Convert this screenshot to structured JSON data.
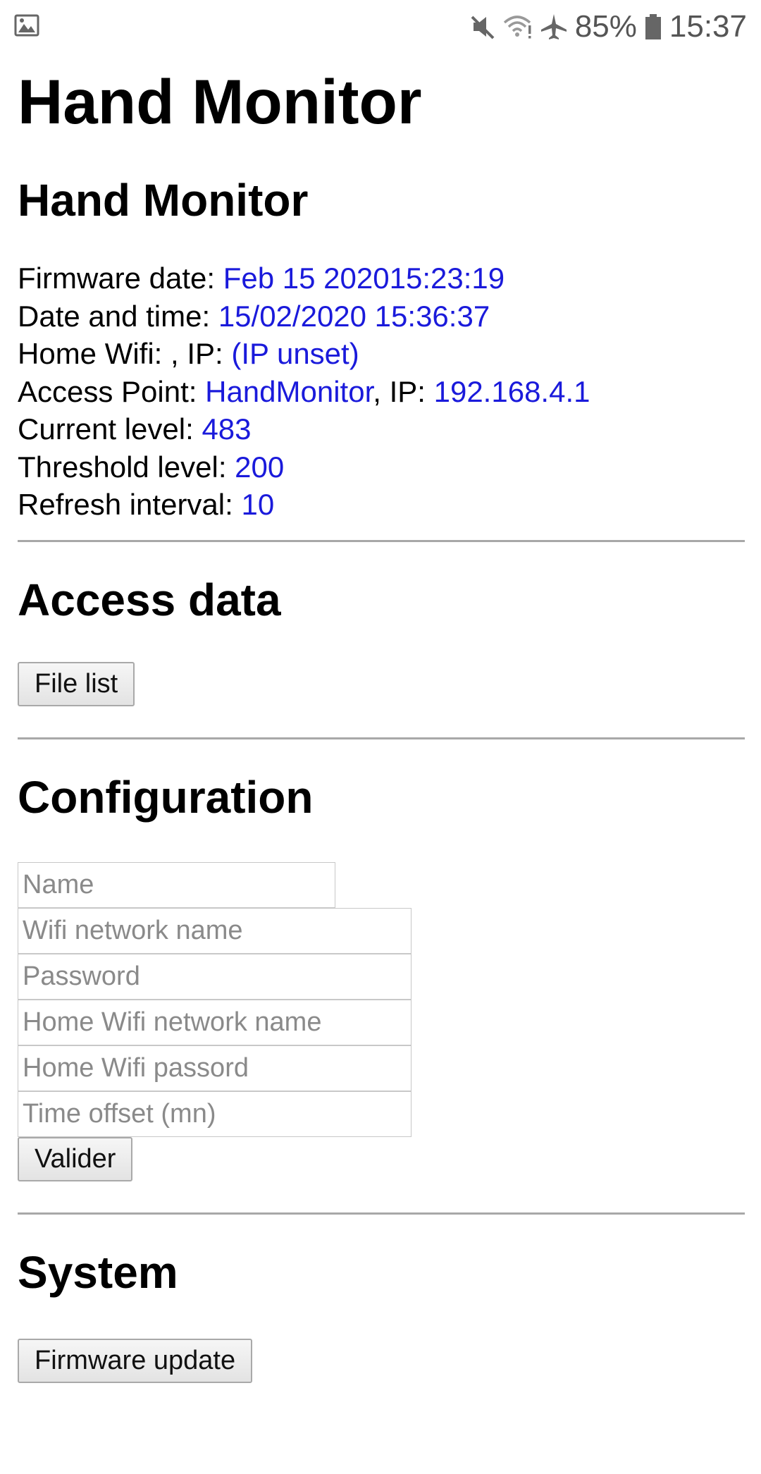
{
  "status_bar": {
    "battery": "85%",
    "time": "15:37",
    "icons": [
      "image-icon",
      "mute-icon",
      "wifi-icon",
      "airplane-icon",
      "battery-icon"
    ]
  },
  "page": {
    "title": "Hand Monitor"
  },
  "status_section": {
    "heading": "Hand Monitor",
    "rows": {
      "firmware_label": "Firmware date: ",
      "firmware_value": "Feb 15 202015:23:19",
      "datetime_label": "Date and time: ",
      "datetime_value": "15/02/2020 15:36:37",
      "home_wifi_label": "Home Wifi: , IP: ",
      "home_wifi_value": "(IP unset)",
      "ap_label": "Access Point: ",
      "ap_name": "HandMonitor",
      "ap_sep": ", IP: ",
      "ap_ip": "192.168.4.1",
      "current_label": "Current level: ",
      "current_value": "483",
      "threshold_label": "Threshold level: ",
      "threshold_value": "200",
      "refresh_label": "Refresh interval: ",
      "refresh_value": "10"
    }
  },
  "access_section": {
    "heading": "Access data",
    "file_list_label": "File list"
  },
  "config_section": {
    "heading": "Configuration",
    "placeholders": {
      "name": "Name",
      "wifi_name": "Wifi network name",
      "password": "Password",
      "home_wifi_name": "Home Wifi network name",
      "home_wifi_password": "Home Wifi passord",
      "time_offset": "Time offset (mn)"
    },
    "submit_label": "Valider"
  },
  "system_section": {
    "heading": "System",
    "firmware_update_label": "Firmware update"
  },
  "colors": {
    "value_blue": "#1a1adb",
    "separator": "#a8a8a8"
  }
}
